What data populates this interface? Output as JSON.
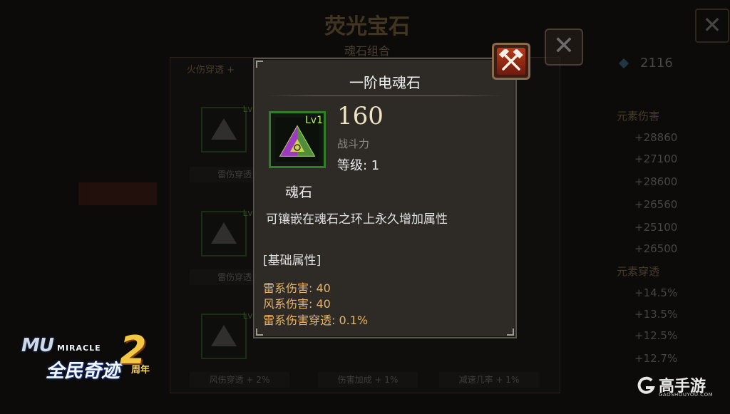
{
  "background": {
    "title": "荧光宝石",
    "subtitle": "魂石组合",
    "tab_label": "火伤穿透 +",
    "power": "2116",
    "slot_level": "Lv1",
    "slot_labels": [
      "雷伤穿透 +",
      "雷伤穿透 +",
      "风伤穿透 + 2%",
      "伤害加成 + 1%",
      "减速几率 + 1%"
    ],
    "section_a": "元素伤害",
    "stats_a": [
      "+28860",
      "+27100",
      "+28600",
      "+26560",
      "+25100",
      "+26500"
    ],
    "section_b": "元素穿透",
    "stats_b": [
      "+14.5%",
      "+13.5%",
      "+12.5%",
      "+12.7%"
    ]
  },
  "popup": {
    "title": "一阶电魂石",
    "item": {
      "level_tag": "Lv1",
      "name": "魂石",
      "icon": "soul-stone-triangle-gem"
    },
    "power_value": "160",
    "power_label": "战斗力",
    "level_text": "等级: 1",
    "description": "可镶嵌在魂石之环上永久增加属性",
    "section_title": "[基础属性]",
    "attributes": [
      "雷系伤害: 40",
      "风系伤害: 40",
      "雷系伤害穿透: 0.1%"
    ]
  },
  "close_icon": "crossed-hammers-icon",
  "logo": {
    "mu": "MU",
    "miracle": "MIRACLE",
    "name": "全民奇迹",
    "number": "2",
    "anniversary": "周年"
  },
  "watermark": {
    "name": "高手游",
    "url": "GAOSHOUYOU.COM"
  },
  "colors": {
    "attribute_text": "#e6b46b",
    "level_green": "#b6f25a",
    "slot_border": "#2f7d26",
    "close_red": "#b83a1a"
  }
}
